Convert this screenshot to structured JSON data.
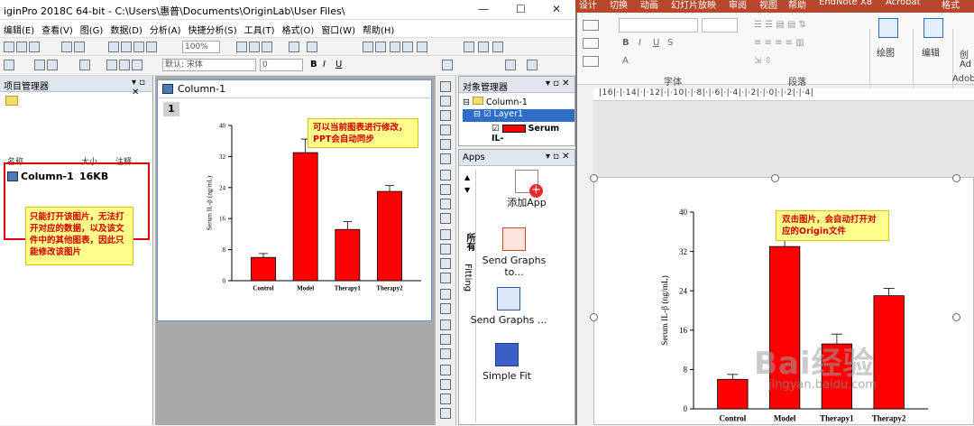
{
  "origin": {
    "title": "iginPro 2018C 64-bit - C:\\Users\\惠普\\Documents\\OriginLab\\User Files\\",
    "menus": [
      "编辑(E)",
      "查看(V)",
      "图(G)",
      "数据(D)",
      "分析(A)",
      "快捷分析(S)",
      "工具(T)",
      "格式(O)",
      "窗口(W)",
      "帮助(H)"
    ],
    "zoom": "100%",
    "font_name": "默认: 宋体",
    "font_size": "0",
    "project_manager": {
      "title": "项目管理器",
      "columns": [
        "名称",
        "大小",
        "注释"
      ],
      "items": [
        {
          "name": "Column-1",
          "size": "16KB"
        }
      ]
    },
    "note_left": "只能打开该图片，无法打开对应的数据，以及该文件中的其他图表，因此只能修改该图片",
    "graph_window": {
      "title": "Column-1",
      "layer": "1"
    },
    "note_mid": "可以当前图表进行修改，PPT会自动同步",
    "object_manager": {
      "title": "对象管理器",
      "root": "Column-1",
      "layer": "Layer1",
      "plot": "Serum IL-"
    },
    "apps": {
      "title": "Apps",
      "tabs": [
        "所有",
        "Fitting"
      ],
      "items": [
        {
          "label": "添加App",
          "icon": "add-app-icon"
        },
        {
          "label": "Send Graphs to...",
          "icon": "send-ppt-icon"
        },
        {
          "label": "Send Graphs ...",
          "icon": "send-word-icon"
        },
        {
          "label": "Simple Fit",
          "icon": "simple-fit-icon"
        }
      ]
    }
  },
  "ppt": {
    "tabs": [
      "设计",
      "切换",
      "动画",
      "幻灯片放映",
      "审阅",
      "视图",
      "帮助",
      "EndNote X8",
      "Acrobat",
      "格式"
    ],
    "groups": [
      "字体",
      "段落",
      "Adob"
    ],
    "buttons": {
      "draw": "绘图",
      "edit": "编辑",
      "create": "创",
      "create2": "Ad"
    },
    "ruler": "|16|·|·14|·|·12|·|·10|·|·8|·|·6|·|·4|·|·2|·|·0|·|·2|·|·4|",
    "note": "双击图片，会自动打开对应的Origin文件",
    "watermark": "Bai经验",
    "watermark_url": "jingyan.baidu.com"
  },
  "chart_data": [
    {
      "type": "bar",
      "categories": [
        "Control",
        "Model",
        "Therapy1",
        "Therapy2"
      ],
      "values": [
        6,
        33,
        13.2,
        23
      ],
      "errors": [
        1,
        3.5,
        2,
        1.5
      ],
      "ylabel": "Serum IL-β (ng/mL)",
      "ylim": [
        0,
        40
      ],
      "yticks": [
        0,
        8,
        16,
        24,
        32,
        40
      ],
      "color": "#ff0000"
    },
    {
      "type": "bar",
      "categories": [
        "Control",
        "Model",
        "Therapy1",
        "Therapy2"
      ],
      "values": [
        6,
        33,
        13.2,
        23
      ],
      "errors": [
        1,
        3.5,
        2,
        1.5
      ],
      "ylabel": "Serum IL-β (ng/mL)",
      "ylim": [
        0,
        40
      ],
      "yticks": [
        0,
        8,
        16,
        24,
        32,
        40
      ],
      "color": "#ff0000"
    }
  ]
}
